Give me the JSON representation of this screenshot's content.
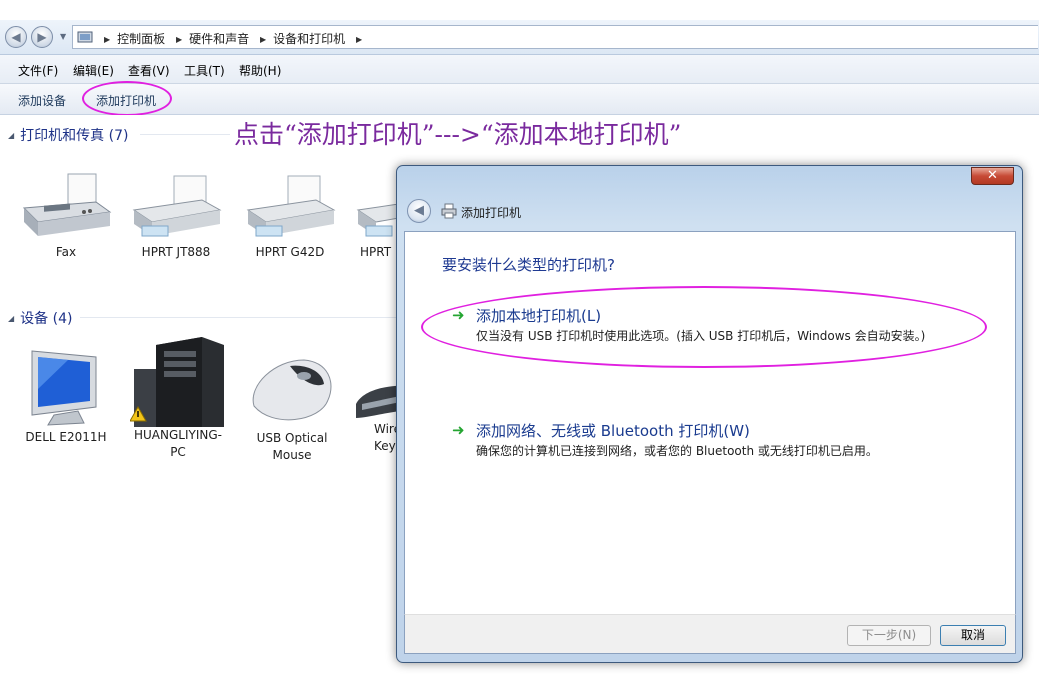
{
  "address": {
    "crumbs": [
      "控制面板",
      "硬件和声音",
      "设备和打印机"
    ]
  },
  "menu": [
    "文件(F)",
    "编辑(E)",
    "查看(V)",
    "工具(T)",
    "帮助(H)"
  ],
  "commands": {
    "add_device": "添加设备",
    "add_printer": "添加打印机"
  },
  "annotation": "点击“添加打印机”--->“添加本地打印机”",
  "groups": {
    "printers": {
      "title": "打印机和传真 (7)",
      "items": [
        "Fax",
        "HPRT JT888",
        "HPRT G42D",
        "HPRT"
      ]
    },
    "devices": {
      "title": "设备 (4)",
      "items": [
        "DELL E2011H",
        "HUANGLIYING-\nPC",
        "USB Optical\nMouse",
        "Wire\nKey"
      ]
    }
  },
  "dialog": {
    "title": "添加打印机",
    "close": "✕",
    "question": "要安装什么类型的打印机?",
    "options": [
      {
        "title": "添加本地打印机(L)",
        "desc": "仅当没有 USB 打印机时使用此选项。(插入 USB 打印机后，Windows 会自动安装。)"
      },
      {
        "title": "添加网络、无线或 Bluetooth 打印机(W)",
        "desc": "确保您的计算机已连接到网络，或者您的 Bluetooth 或无线打印机已启用。"
      }
    ],
    "next_button": "下一步(N)",
    "cancel_button": "取消"
  },
  "colors": {
    "highlight": "#e020e0",
    "annotation": "#7a2a9e",
    "link_blue": "#1a3b8f",
    "arrow_green": "#25a532"
  }
}
